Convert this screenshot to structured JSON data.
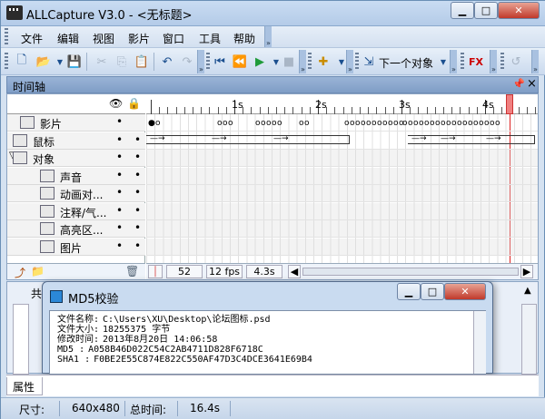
{
  "window": {
    "title": "ALLCapture V3.0 - <无标题>"
  },
  "menu": [
    "文件",
    "编辑",
    "视图",
    "影片",
    "窗口",
    "工具",
    "帮助"
  ],
  "toolbar": {
    "next_object_label": "下一个对象"
  },
  "timeline_panel": {
    "title": "时间轴",
    "pin": "ᴥ",
    "close": "×",
    "ruler_labels": [
      "1s",
      "2s",
      "3s",
      "4s"
    ],
    "tracks": [
      {
        "label": "影片",
        "icon": "film-camera-icon",
        "dot1": "•",
        "dot2": ""
      },
      {
        "label": "鼠标",
        "icon": "mouse-icon",
        "dot1": "•",
        "dot2": "•"
      },
      {
        "label": "对象",
        "icon": "folder-icon",
        "dot1": "•",
        "dot2": "•"
      },
      {
        "label": "声音",
        "icon": "sound-icon",
        "dot1": "•",
        "dot2": "•"
      },
      {
        "label": "动画对...",
        "icon": "animation-object-icon",
        "dot1": "•",
        "dot2": "•"
      },
      {
        "label": "注释/气...",
        "icon": "annotation-icon",
        "dot1": "•",
        "dot2": "•"
      },
      {
        "label": "高亮区...",
        "icon": "highlight-region-icon",
        "dot1": "•",
        "dot2": "•"
      },
      {
        "label": "图片",
        "icon": "picture-icon",
        "dot1": "•",
        "dot2": "•"
      }
    ],
    "footer": {
      "frame": "52",
      "fps": "12 fps",
      "duration": "4.3s"
    }
  },
  "lower_panel": {
    "tab_label": "共"
  },
  "dialog": {
    "title": "MD5校验",
    "lines": [
      {
        "label": "文件名称:",
        "value": "C:\\Users\\XU\\Desktop\\论坛图标.psd"
      },
      {
        "label": "文件大小:",
        "value": "18255375 字节"
      },
      {
        "label": "修改时间:",
        "value": "2013年8月20日 14:06:58"
      },
      {
        "label": "MD5     :",
        "value": "A058B46D022C54C2AB4711D828F6718C"
      },
      {
        "label": "SHA1    :",
        "value": "F0BE2E55C874E822C550AF47D3C4DCE3641E69B4"
      }
    ]
  },
  "bottom_tab": "属性",
  "status": {
    "size_label": "尺寸:",
    "size_value": "640x480",
    "time_label": "总时间:",
    "time_value": "16.4s"
  }
}
